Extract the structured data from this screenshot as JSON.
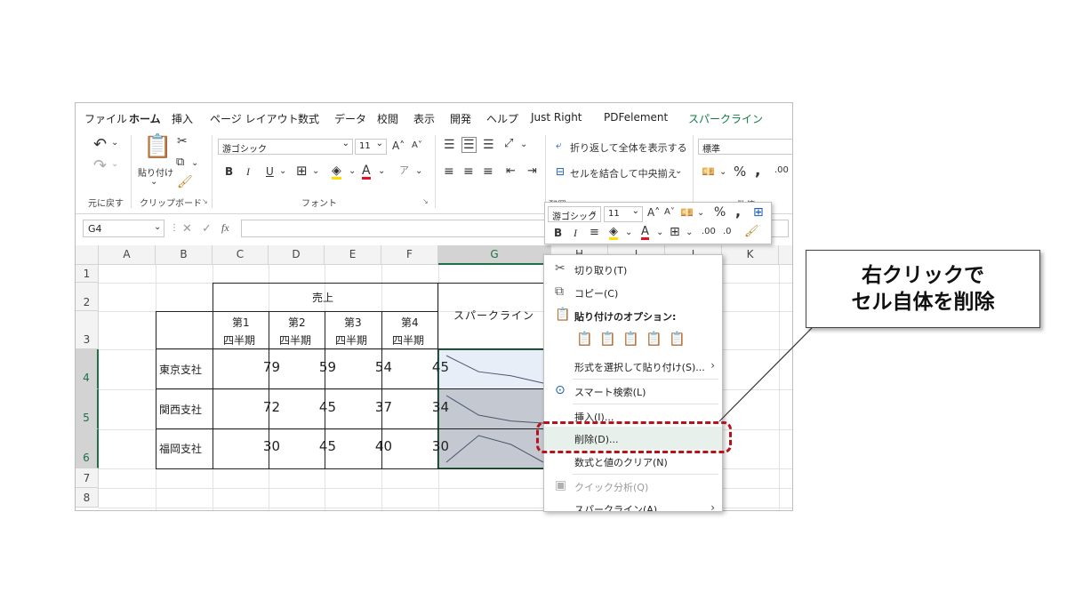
{
  "ribbon_tabs": [
    "ファイル",
    "ホーム",
    "挿入",
    "ページ レイアウト",
    "数式",
    "データ",
    "校閲",
    "表示",
    "開発",
    "ヘルプ",
    "Just Right",
    "PDFelement",
    "スパークライン"
  ],
  "ribbon": {
    "undo_group": "元に戻す",
    "clipboard_group": "クリップボード",
    "paste_label": "貼り付け",
    "font_group": "フォント",
    "font_name": "游ゴシック",
    "font_size": "11",
    "align_group": "配置",
    "number_group": "数値",
    "wrap_text": "折り返して全体を表示する",
    "merge_center": "セルを結合して中央揃え",
    "number_format": "標準"
  },
  "formula_bar": {
    "name_box": "G4",
    "fx": "fx"
  },
  "columns": [
    "A",
    "B",
    "C",
    "D",
    "E",
    "F",
    "G",
    "H",
    "I",
    "J",
    "K"
  ],
  "rows": [
    "1",
    "2",
    "3",
    "4",
    "5",
    "6",
    "7",
    "8"
  ],
  "table": {
    "header_sales": "売上",
    "quarters": [
      {
        "top": "第1",
        "bottom": "四半期"
      },
      {
        "top": "第2",
        "bottom": "四半期"
      },
      {
        "top": "第3",
        "bottom": "四半期"
      },
      {
        "top": "第4",
        "bottom": "四半期"
      }
    ],
    "sparkline_header": "スパークライン",
    "branches": [
      {
        "name": "東京支社",
        "values": [
          79,
          59,
          54,
          45
        ]
      },
      {
        "name": "関西支社",
        "values": [
          72,
          45,
          37,
          34
        ]
      },
      {
        "name": "福岡支社",
        "values": [
          30,
          45,
          40,
          30
        ]
      }
    ]
  },
  "mini_toolbar": {
    "font_name": "游ゴシック",
    "font_size": "11"
  },
  "context_menu": {
    "cut": "切り取り(T)",
    "copy": "コピー(C)",
    "paste_options": "貼り付けのオプション:",
    "paste_special": "形式を選択して貼り付け(S)...",
    "smart_lookup": "スマート検索(L)",
    "insert": "挿入(I)...",
    "delete": "削除(D)...",
    "clear": "数式と値のクリア(N)",
    "quick_analysis": "クイック分析(Q)",
    "sparklines": "スパークライン(A)"
  },
  "callout": {
    "line1": "右クリックで",
    "line2": "セル自体を削除"
  },
  "colors": {
    "excel_green": "#1e7145",
    "highlight_red": "#b5121b",
    "selection_fill": "#e8eef8",
    "sparkline_fill": "#c4c8d0"
  }
}
